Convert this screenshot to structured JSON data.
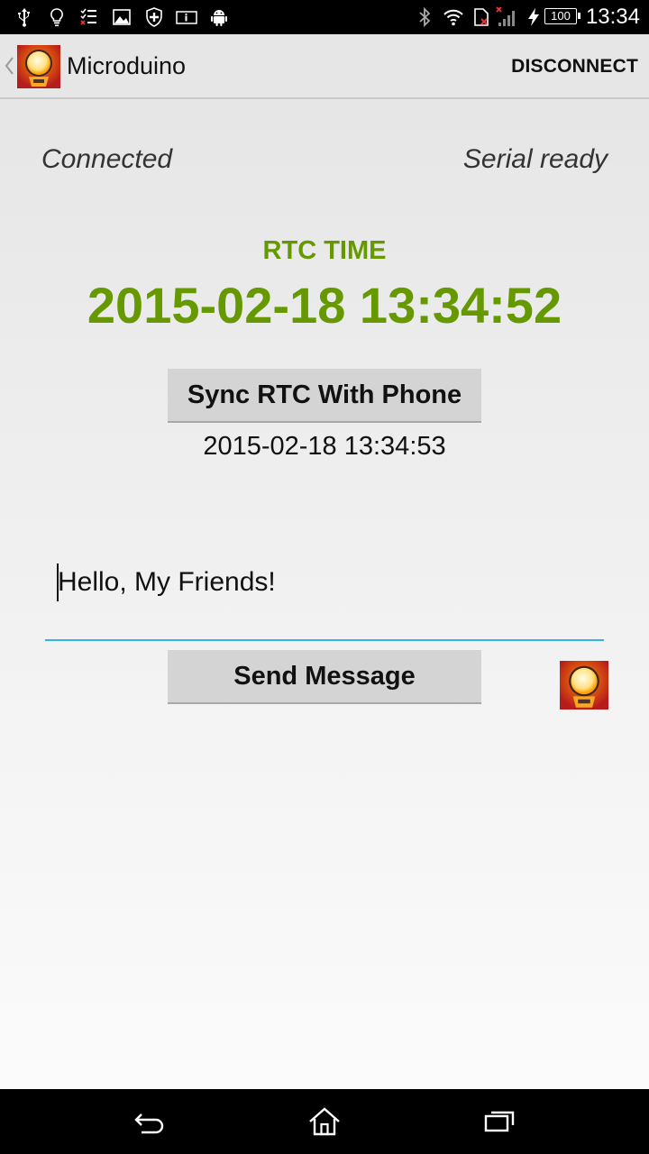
{
  "status_bar": {
    "time": "13:34",
    "battery": "100",
    "icons": [
      "usb-icon",
      "bulb-icon",
      "checklist-icon",
      "image-icon",
      "shield-icon",
      "info-card-icon",
      "android-icon",
      "bluetooth-icon",
      "wifi-icon",
      "sim-icon",
      "signal-icon",
      "charging-icon",
      "battery-icon"
    ]
  },
  "action_bar": {
    "title": "Microduino",
    "disconnect_label": "DISCONNECT"
  },
  "main": {
    "connection_status": "Connected",
    "serial_status": "Serial ready",
    "rtc_label": "RTC TIME",
    "rtc_time": "2015-02-18 13:34:52",
    "sync_button_label": "Sync RTC With Phone",
    "phone_time": "2015-02-18 13:34:53",
    "message_value": "Hello, My Friends!",
    "send_button_label": "Send Message"
  },
  "nav_bar": {
    "icons": [
      "back-icon",
      "home-icon",
      "recents-icon"
    ]
  },
  "colors": {
    "accent_green": "#669900",
    "field_underline": "#33b5e5"
  }
}
